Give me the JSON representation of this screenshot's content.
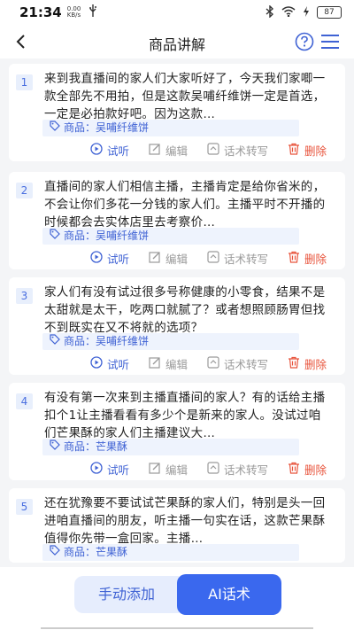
{
  "status_bar": {
    "time": "21:34",
    "speed": "0.00 KB/s",
    "battery": "87"
  },
  "header": {
    "title": "商品讲解"
  },
  "actions": {
    "listen": "试听",
    "edit": "编辑",
    "transcribe": "话术转写",
    "delete": "删除"
  },
  "scripts": [
    {
      "index": "1",
      "text": "来到我直播间的家人们大家听好了，今天我们家唧一款全部先不用拍，但是这款吴哺纤维饼一定是首选，一定是必拍款好吧。因为这款…",
      "product": "商品：吴哺纤维饼"
    },
    {
      "index": "2",
      "text": "直播间的家人们相信主播，主播肯定是给你省米的，不会让你们多花一分钱的家人们。主播平时不开播的时候都会去实体店里去考察价…",
      "product": "商品：吴哺纤维饼"
    },
    {
      "index": "3",
      "text": "家人们有没有试过很多号称健康的小零食，结果不是太甜就是太干，吃两口就腻了？或者想照顾肠胃但找不到既实在又不将就的选项？",
      "product": "商品：吴哺纤维饼"
    },
    {
      "index": "4",
      "text": "有没有第一次来到主播直播间的家人？有的话给主播扣个1让主播看看有多少个是新来的家人。没试过咱们芒果酥的家人们主播建议大…",
      "product": "商品：芒果酥"
    },
    {
      "index": "5",
      "text": "还在犹豫要不要试试芒果酥的家人们，特别是头一回进咱直播间的朋友，听主播一句实在话，这款芒果酥值得你先带一盒回家。主播…",
      "product": "商品：芒果酥"
    }
  ],
  "bottom": {
    "manual_add": "手动添加",
    "ai_script": "AI话术"
  }
}
